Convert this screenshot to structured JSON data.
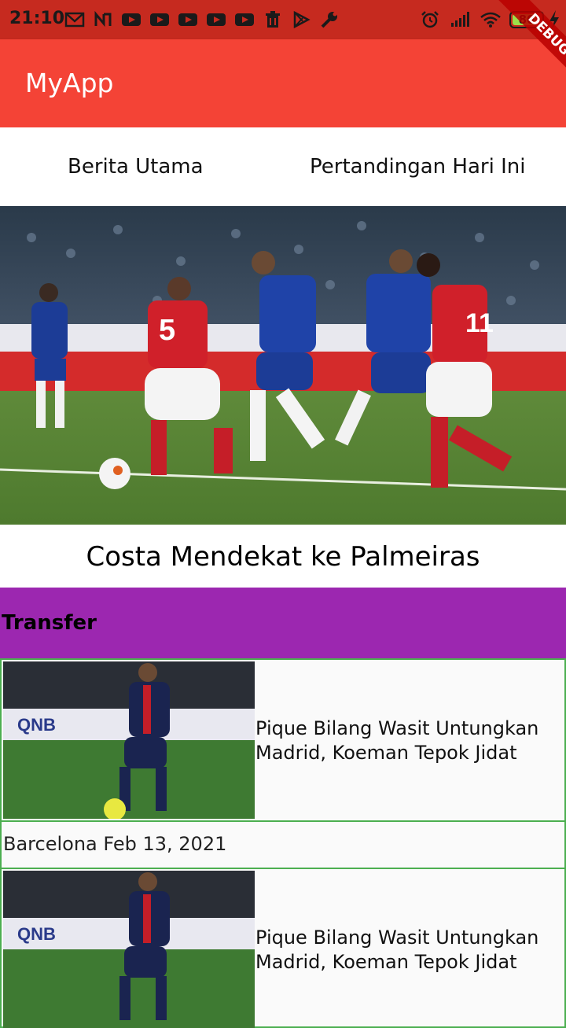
{
  "status_bar": {
    "time": "21:10",
    "battery_level": "80",
    "battery_percent": 80,
    "left_icons": [
      "gmail-icon",
      "notification-icon",
      "youtube-icon",
      "youtube-icon",
      "youtube-icon",
      "youtube-icon",
      "youtube-icon",
      "trash-icon",
      "play-store-icon",
      "wrench-icon"
    ],
    "right_icons": [
      "alarm-icon",
      "signal-icon",
      "wifi-icon",
      "battery-icon",
      "charging-icon"
    ]
  },
  "app_bar": {
    "title": "MyApp",
    "color": "#f44336",
    "debug_label": "DEBUG"
  },
  "tabs": [
    {
      "label": "Berita Utama"
    },
    {
      "label": "Pertandingan Hari Ini"
    }
  ],
  "hero": {
    "image": "football-match-photo",
    "headline": "Costa Mendekat ke Palmeiras"
  },
  "section": {
    "label": "Transfer",
    "color": "#9c27b0"
  },
  "news": [
    {
      "image": "player-photo",
      "title": "Pique Bilang Wasit Untungkan Madrid, Koeman  Tepok Jidat",
      "meta": "Barcelona Feb 13, 2021"
    },
    {
      "image": "player-photo",
      "title": "Pique Bilang Wasit Untungkan Madrid, Koeman  Tepok Jidat"
    }
  ],
  "colors": {
    "status_bar": "#c62a1f",
    "card_border": "#4caf50"
  }
}
